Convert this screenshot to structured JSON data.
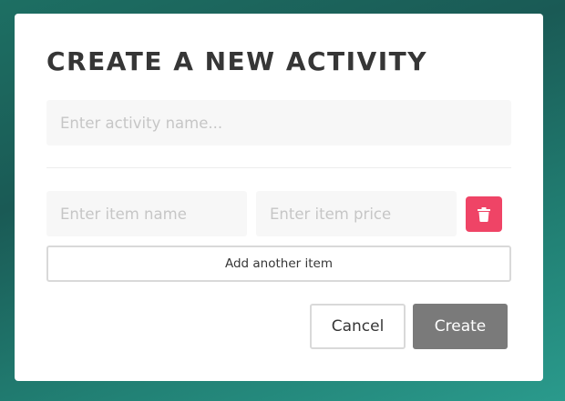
{
  "modal": {
    "title": "CREATE A NEW ACTIVITY",
    "activity_name": {
      "value": "",
      "placeholder": "Enter activity name..."
    },
    "items": [
      {
        "name": {
          "value": "",
          "placeholder": "Enter item name"
        },
        "price": {
          "value": "",
          "placeholder": "Enter item price"
        },
        "delete_icon": "trash-icon"
      }
    ],
    "add_item_label": "Add another item",
    "cancel_label": "Cancel",
    "create_label": "Create"
  },
  "colors": {
    "delete_button": "#ef4466",
    "create_button": "#7a7a7a",
    "input_background": "#f7f7f7",
    "backdrop": "#1d6f63"
  }
}
